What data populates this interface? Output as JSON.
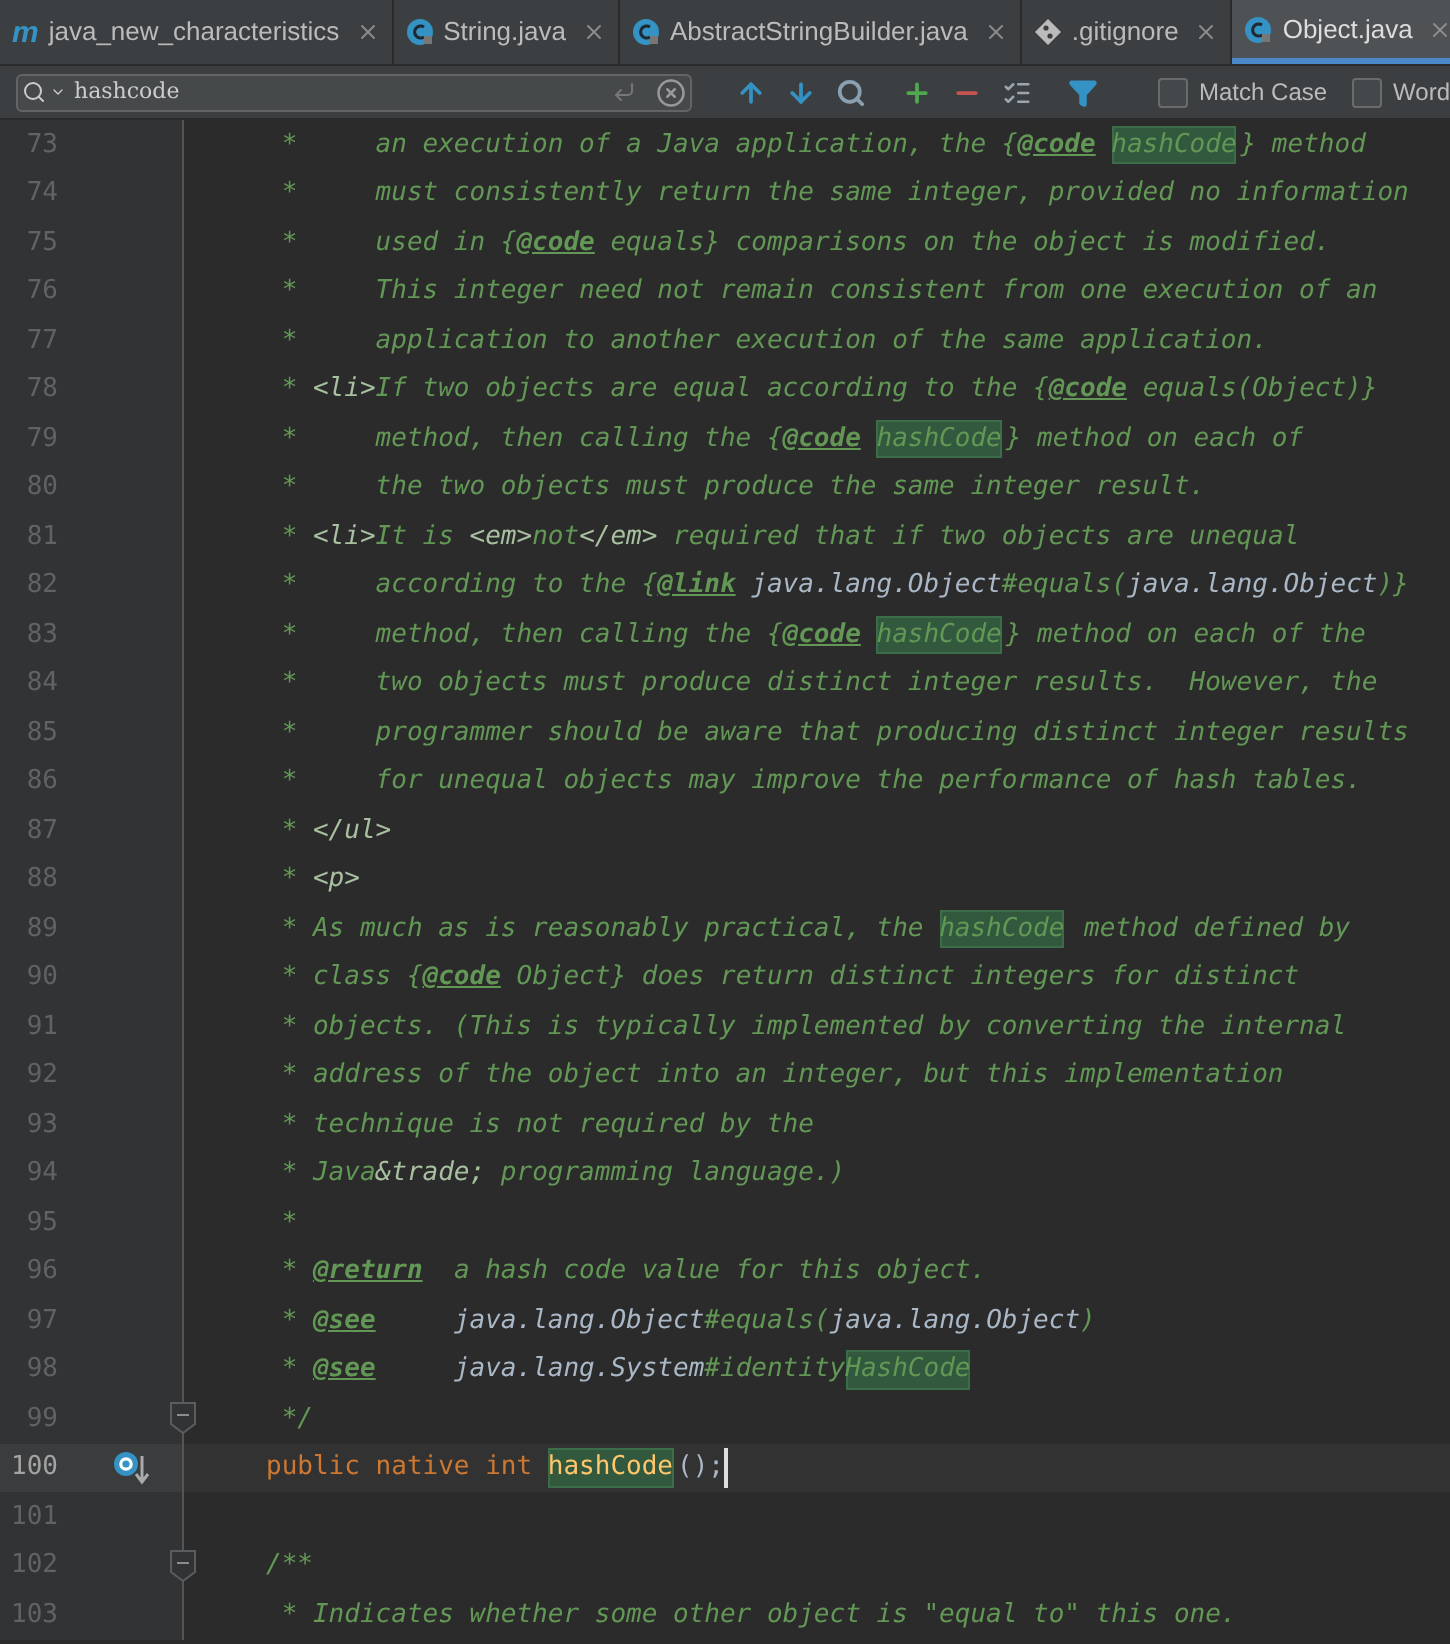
{
  "tabs": [
    {
      "label": "java_new_characteristics",
      "kind": "module",
      "icon_letter": "m",
      "selected": false
    },
    {
      "label": "String.java",
      "kind": "class",
      "selected": false
    },
    {
      "label": "AbstractStringBuilder.java",
      "kind": "class",
      "selected": false
    },
    {
      "label": ".gitignore",
      "kind": "git",
      "selected": false
    },
    {
      "label": "Object.java",
      "kind": "class",
      "selected": true
    }
  ],
  "search": {
    "value": "hashcode",
    "options": [
      {
        "label": "Match Case",
        "checked": false
      },
      {
        "label": "Word",
        "checked": false
      }
    ]
  },
  "lines": [
    {
      "number": "73",
      "fold": false,
      "current": false,
      "override": false,
      "segments": [
        {
          "kind": "c",
          "text": " *     an execution of a Java application, the {"
        },
        {
          "kind": "tag",
          "text": "@code "
        },
        {
          "kind": "c",
          "text": "hashCode",
          "match": true
        },
        {
          "kind": "c",
          "text": "} method"
        }
      ]
    },
    {
      "number": "74",
      "fold": false,
      "current": false,
      "override": false,
      "segments": [
        {
          "kind": "c",
          "text": " *     must consistently return the same integer, provided no information"
        }
      ]
    },
    {
      "number": "75",
      "fold": false,
      "current": false,
      "override": false,
      "segments": [
        {
          "kind": "c",
          "text": " *     used in {"
        },
        {
          "kind": "tag",
          "text": "@code"
        },
        {
          "kind": "c",
          "text": " equals} comparisons on the object is modified."
        }
      ]
    },
    {
      "number": "76",
      "fold": false,
      "current": false,
      "override": false,
      "segments": [
        {
          "kind": "c",
          "text": " *     This integer need not remain consistent from one execution of an"
        }
      ]
    },
    {
      "number": "77",
      "fold": false,
      "current": false,
      "override": false,
      "segments": [
        {
          "kind": "c",
          "text": " *     application to another execution of the same application."
        }
      ]
    },
    {
      "number": "78",
      "fold": false,
      "current": false,
      "override": false,
      "segments": [
        {
          "kind": "c",
          "text": " * "
        },
        {
          "kind": "html",
          "text": "<li>"
        },
        {
          "kind": "c",
          "text": "If two objects are equal according to the {"
        },
        {
          "kind": "tag",
          "text": "@code"
        },
        {
          "kind": "c",
          "text": " equals(Object)}"
        }
      ]
    },
    {
      "number": "79",
      "fold": false,
      "current": false,
      "override": false,
      "segments": [
        {
          "kind": "c",
          "text": " *     method, then calling the {"
        },
        {
          "kind": "tag",
          "text": "@code "
        },
        {
          "kind": "c",
          "text": "hashCode",
          "match": true
        },
        {
          "kind": "c",
          "text": "} method on each of"
        }
      ]
    },
    {
      "number": "80",
      "fold": false,
      "current": false,
      "override": false,
      "segments": [
        {
          "kind": "c",
          "text": " *     the two objects must produce the same integer result."
        }
      ]
    },
    {
      "number": "81",
      "fold": false,
      "current": false,
      "override": false,
      "segments": [
        {
          "kind": "c",
          "text": " * "
        },
        {
          "kind": "html",
          "text": "<li>"
        },
        {
          "kind": "c",
          "text": "It is "
        },
        {
          "kind": "html",
          "text": "<em>"
        },
        {
          "kind": "c",
          "text": "not"
        },
        {
          "kind": "html",
          "text": "</em>"
        },
        {
          "kind": "c",
          "text": " required that if two objects are unequal"
        }
      ]
    },
    {
      "number": "82",
      "fold": false,
      "current": false,
      "override": false,
      "segments": [
        {
          "kind": "c",
          "text": " *     according to the {"
        },
        {
          "kind": "tag",
          "text": "@link"
        },
        {
          "kind": "ref",
          "text": " java.lang.Object"
        },
        {
          "kind": "c",
          "text": "#equals("
        },
        {
          "kind": "ref",
          "text": "java.lang.Object"
        },
        {
          "kind": "c",
          "text": ")}"
        }
      ]
    },
    {
      "number": "83",
      "fold": false,
      "current": false,
      "override": false,
      "segments": [
        {
          "kind": "c",
          "text": " *     method, then calling the {"
        },
        {
          "kind": "tag",
          "text": "@code "
        },
        {
          "kind": "c",
          "text": "hashCode",
          "match": true
        },
        {
          "kind": "c",
          "text": "} method on each of the"
        }
      ]
    },
    {
      "number": "84",
      "fold": false,
      "current": false,
      "override": false,
      "segments": [
        {
          "kind": "c",
          "text": " *     two objects must produce distinct integer results.  However, the"
        }
      ]
    },
    {
      "number": "85",
      "fold": false,
      "current": false,
      "override": false,
      "segments": [
        {
          "kind": "c",
          "text": " *     programmer should be aware that producing distinct integer results"
        }
      ]
    },
    {
      "number": "86",
      "fold": false,
      "current": false,
      "override": false,
      "segments": [
        {
          "kind": "c",
          "text": " *     for unequal objects may improve the performance of hash tables."
        }
      ]
    },
    {
      "number": "87",
      "fold": false,
      "current": false,
      "override": false,
      "segments": [
        {
          "kind": "c",
          "text": " * "
        },
        {
          "kind": "html",
          "text": "</ul>"
        }
      ]
    },
    {
      "number": "88",
      "fold": false,
      "current": false,
      "override": false,
      "segments": [
        {
          "kind": "c",
          "text": " * "
        },
        {
          "kind": "html",
          "text": "<p>"
        }
      ]
    },
    {
      "number": "89",
      "fold": false,
      "current": false,
      "override": false,
      "segments": [
        {
          "kind": "c",
          "text": " * As much as is reasonably practical, the "
        },
        {
          "kind": "c",
          "text": "hashCode",
          "match": true
        },
        {
          "kind": "c",
          "text": " method defined by"
        }
      ]
    },
    {
      "number": "90",
      "fold": false,
      "current": false,
      "override": false,
      "segments": [
        {
          "kind": "c",
          "text": " * class {"
        },
        {
          "kind": "tag",
          "text": "@code"
        },
        {
          "kind": "c",
          "text": " Object} does return distinct integers for distinct"
        }
      ]
    },
    {
      "number": "91",
      "fold": false,
      "current": false,
      "override": false,
      "segments": [
        {
          "kind": "c",
          "text": " * objects. (This is typically implemented by converting the internal"
        }
      ]
    },
    {
      "number": "92",
      "fold": false,
      "current": false,
      "override": false,
      "segments": [
        {
          "kind": "c",
          "text": " * address of the object into an integer, but this implementation"
        }
      ]
    },
    {
      "number": "93",
      "fold": false,
      "current": false,
      "override": false,
      "segments": [
        {
          "kind": "c",
          "text": " * technique is not required by the"
        }
      ]
    },
    {
      "number": "94",
      "fold": false,
      "current": false,
      "override": false,
      "segments": [
        {
          "kind": "c",
          "text": " * Java"
        },
        {
          "kind": "html",
          "text": "&trade;"
        },
        {
          "kind": "c",
          "text": " programming language.)"
        }
      ]
    },
    {
      "number": "95",
      "fold": false,
      "current": false,
      "override": false,
      "segments": [
        {
          "kind": "c",
          "text": " *"
        }
      ]
    },
    {
      "number": "96",
      "fold": false,
      "current": false,
      "override": false,
      "segments": [
        {
          "kind": "c",
          "text": " * "
        },
        {
          "kind": "tag",
          "text": "@return"
        },
        {
          "kind": "c",
          "text": "  a hash code value for this object."
        }
      ]
    },
    {
      "number": "97",
      "fold": false,
      "current": false,
      "override": false,
      "segments": [
        {
          "kind": "c",
          "text": " * "
        },
        {
          "kind": "tag",
          "text": "@see     "
        },
        {
          "kind": "ref",
          "text": "java.lang.Object"
        },
        {
          "kind": "c",
          "text": "#equals("
        },
        {
          "kind": "ref",
          "text": "java.lang.Object"
        },
        {
          "kind": "c",
          "text": ")"
        }
      ]
    },
    {
      "number": "98",
      "fold": false,
      "current": false,
      "override": false,
      "segments": [
        {
          "kind": "c",
          "text": " * "
        },
        {
          "kind": "tag",
          "text": "@see     "
        },
        {
          "kind": "ref",
          "text": "java.lang.System"
        },
        {
          "kind": "c",
          "text": "#identity"
        },
        {
          "kind": "c",
          "text": "HashCode",
          "match": true
        }
      ]
    },
    {
      "number": "99",
      "fold": true,
      "current": false,
      "override": false,
      "segments": [
        {
          "kind": "c",
          "text": " */"
        }
      ]
    },
    {
      "number": "100",
      "fold": false,
      "current": true,
      "override": true,
      "segments": [
        {
          "kind": "kw",
          "text": "public native int "
        },
        {
          "kind": "method",
          "text": "hashCode",
          "match": true
        },
        {
          "kind": "plain",
          "text": "();"
        }
      ]
    },
    {
      "number": "101",
      "fold": false,
      "current": false,
      "override": false
    },
    {
      "number": "102",
      "fold": true,
      "current": false,
      "override": false,
      "segments": [
        {
          "kind": "c",
          "text": "/**"
        }
      ]
    },
    {
      "number": "103",
      "fold": false,
      "current": false,
      "override": false,
      "segments": [
        {
          "kind": "c",
          "text": " * Indicates whether some other object is \"equal to\" this one."
        }
      ]
    }
  ]
}
